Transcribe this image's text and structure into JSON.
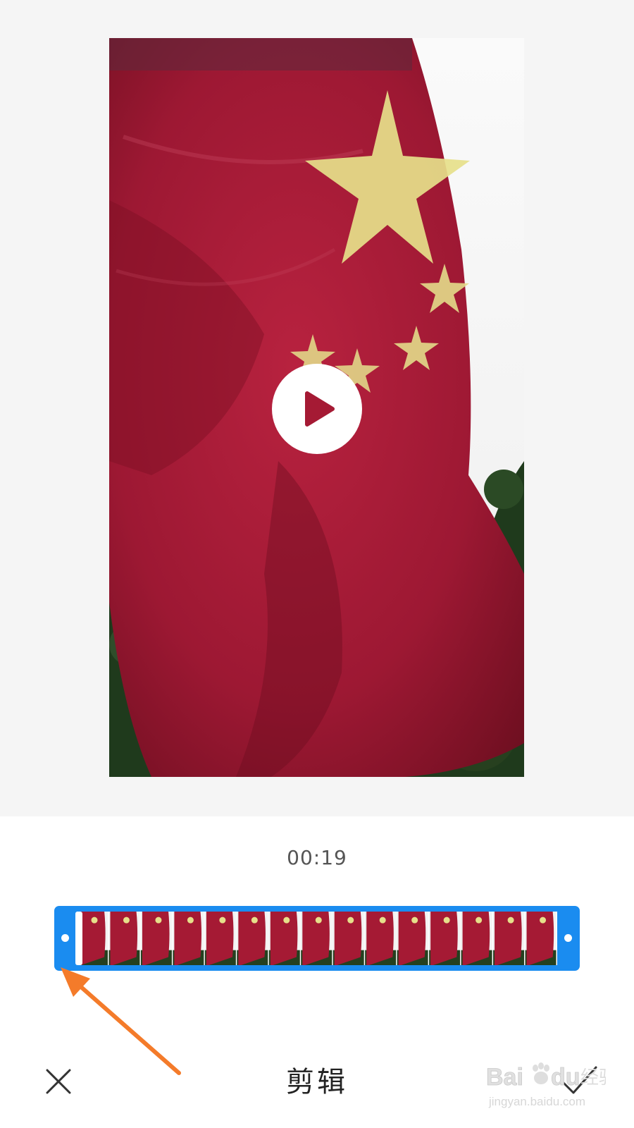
{
  "player": {
    "duration": "00:19",
    "play_icon": "play-icon"
  },
  "trim": {
    "frame_count": 15,
    "start_fraction": 0.0,
    "end_fraction": 1.0
  },
  "bottom_bar": {
    "title": "剪辑",
    "cancel_icon": "close-icon",
    "confirm_icon": "check-icon"
  },
  "colors": {
    "accent": "#1a8cf0",
    "arrow": "#f47b2a",
    "flag_red": "#a51a34",
    "star_yellow": "#e6e08a"
  },
  "watermark": {
    "brand": "Baidu经验",
    "url": "jingyan.baidu.com"
  }
}
